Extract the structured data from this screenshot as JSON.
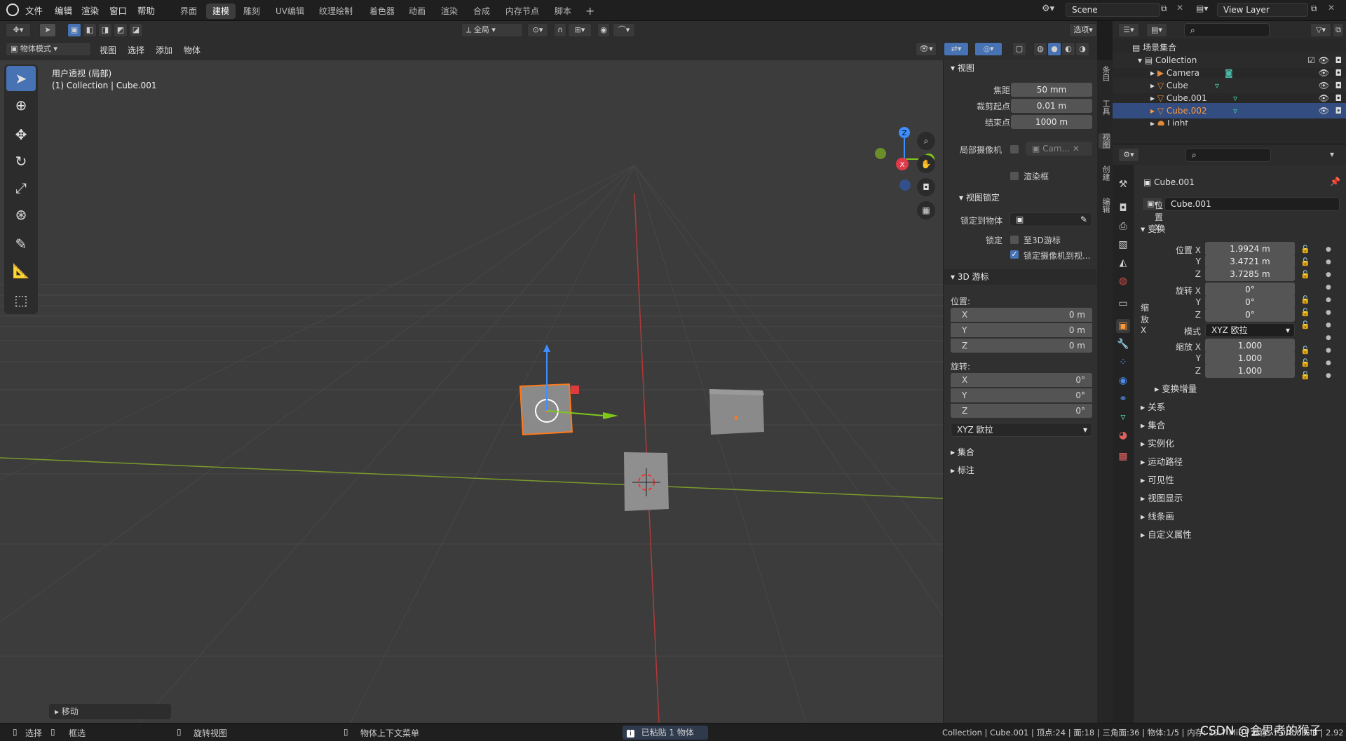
{
  "menu": {
    "items": [
      "文件",
      "编辑",
      "渲染",
      "窗口",
      "帮助"
    ]
  },
  "workspaces": [
    "界面",
    "建模",
    "雕刻",
    "UV编辑",
    "纹理绘制",
    "着色器",
    "动画",
    "渲染",
    "合成",
    "内存节点",
    "脚本"
  ],
  "active_workspace": "建模",
  "scene": "Scene",
  "view_layer": "View Layer",
  "header": {
    "mode": "物体模式",
    "menus": [
      "视图",
      "选择",
      "添加",
      "物体"
    ],
    "transform_orientation": "全局",
    "options": "选项"
  },
  "viewport": {
    "title": "用户透视 (局部)",
    "subtitle": "(1) Collection | Cube.001",
    "axis_x": "X",
    "axis_y": "Y",
    "axis_z": "Z"
  },
  "operator_panel": {
    "label": "移动"
  },
  "npanel": {
    "view_header": "视图",
    "focal_label": "焦距",
    "focal_value": "50 mm",
    "clip_start_label": "裁剪起点",
    "clip_start_value": "0.01 m",
    "clip_end_label": "结束点",
    "clip_end_value": "1000 m",
    "local_camera_label": "局部摄像机",
    "local_camera_value": "Cam...",
    "render_border_label": "渲染框",
    "view_lock_header": "视图锁定",
    "lock_object_label": "锁定到物体",
    "lock_label": "锁定",
    "lock_cursor_label": "至3D游标",
    "lock_camera_label": "锁定摄像机到视...",
    "cursor_header": "3D 游标",
    "location_label": "位置:",
    "rotation_label": "旋转:",
    "cursor_loc": [
      {
        "axis": "X",
        "value": "0 m"
      },
      {
        "axis": "Y",
        "value": "0 m"
      },
      {
        "axis": "Z",
        "value": "0 m"
      }
    ],
    "cursor_rot": [
      {
        "axis": "X",
        "value": "0°"
      },
      {
        "axis": "Y",
        "value": "0°"
      },
      {
        "axis": "Z",
        "value": "0°"
      }
    ],
    "rotation_mode": "XYZ 欧拉",
    "collection_header": "集合",
    "annotation_header": "标注",
    "tabs": [
      "条目",
      "工具",
      "视图",
      "创建",
      "编辑"
    ]
  },
  "outliner": {
    "search_placeholder": "",
    "scene_collection": "场景集合",
    "collection": "Collection",
    "items": [
      "Camera",
      "Cube",
      "Cube.001",
      "Cube.002",
      "Light"
    ]
  },
  "properties": {
    "object_name": "Cube.001",
    "data_name": "Cube.001",
    "transform_header": "变换",
    "location_label": "位置 X",
    "location": [
      "1.9924 m",
      "3.4721 m",
      "3.7285 m"
    ],
    "rotation_label": "旋转 X",
    "rotation": [
      "0°",
      "0°",
      "0°"
    ],
    "mode_label": "模式",
    "mode_value": "XYZ 欧拉",
    "scale_label": "缩放 X",
    "scale": [
      "1.000",
      "1.000",
      "1.000"
    ],
    "y_label": "Y",
    "z_label": "Z",
    "delta_transform": "变换增量",
    "sections": [
      "关系",
      "集合",
      "实例化",
      "运动路径",
      "可见性",
      "视图显示",
      "线条画",
      "自定义属性"
    ]
  },
  "statusbar": {
    "select": "选择",
    "box_select": "框选",
    "rotate_view": "旋转视图",
    "context_menu": "物体上下文菜单",
    "notice": "已粘贴 1 物体",
    "stats": "Collection | Cube.001 | 顶点:24 | 面:18 | 三角面:36 | 物体:1/5 | 内存: 19.7 MiB | 显存: 1.0/8.0 GiB | 2.92",
    "watermark": "CSDN @会思考的猴子"
  }
}
